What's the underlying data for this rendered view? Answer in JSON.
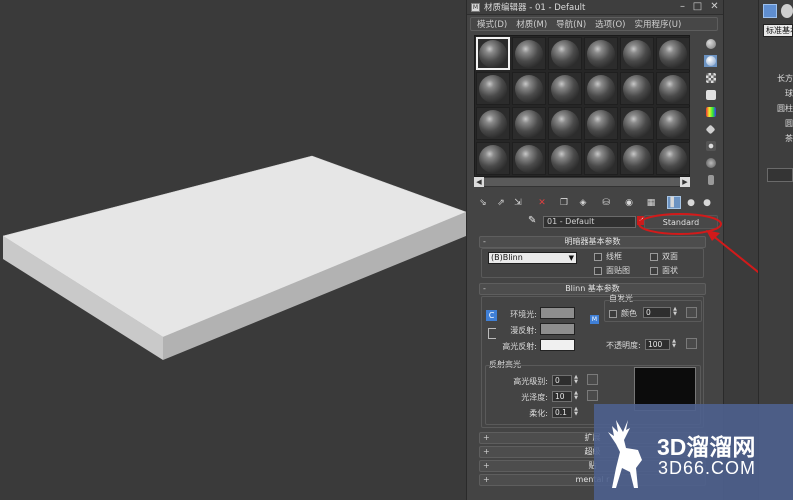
{
  "window": {
    "icon_text": "M",
    "title": "材质编辑器 - 01 - Default",
    "minimize": "–",
    "maximize": "□",
    "close": "✕"
  },
  "menu": [
    "模式(D)",
    "材质(M)",
    "导航(N)",
    "选项(O)",
    "实用程序(U)"
  ],
  "slots": {
    "rows": 4,
    "columns": 6,
    "active_index": 0
  },
  "scrollbar": {
    "left_arrow": "◀",
    "right_arrow": "▶"
  },
  "material": {
    "name": "01 - Default",
    "type_button": "Standard",
    "eyedropper_icon": "eyedropper-icon",
    "red_check_icon": "check-icon"
  },
  "shader_rollout": {
    "toggle": "-",
    "title": "明暗器基本参数",
    "shader": "(B)Blinn",
    "checkboxes": [
      {
        "label": "线框",
        "checked": false
      },
      {
        "label": "双面",
        "checked": false
      },
      {
        "label": "面贴图",
        "checked": false
      },
      {
        "label": "面状",
        "checked": false
      }
    ]
  },
  "blinn_rollout": {
    "toggle": "-",
    "title": "Blinn 基本参数",
    "ambient_label": "环境光:",
    "diffuse_label": "漫反射:",
    "specular_label": "高光反射:",
    "self_illum_title": "自发光",
    "color_label": "颜色",
    "color_value": "0",
    "opacity_label": "不透明度:",
    "opacity_value": "100",
    "lock_button": "C",
    "map_button": "M"
  },
  "specular_highlights": {
    "title": "反射高光",
    "level_label": "高光级别:",
    "level_value": "0",
    "gloss_label": "光泽度:",
    "gloss_value": "10",
    "soften_label": "柔化:",
    "soften_value": "0.1"
  },
  "collapsed_rollouts": [
    {
      "toggle": "+",
      "title": "扩展"
    },
    {
      "toggle": "+",
      "title": "超级"
    },
    {
      "toggle": "+",
      "title": "贴"
    },
    {
      "toggle": "+",
      "title": "mental r"
    }
  ],
  "command_panel": {
    "dropdown": "标准基本",
    "buttons": [
      "长方",
      "球",
      "圆柱",
      "圆",
      "茶"
    ]
  },
  "watermark": {
    "title": "3D溜溜网",
    "url": "3D66.COM"
  },
  "colors": {
    "viewport_bg": "#3a3a3a",
    "box_top": "#e6e6e6",
    "box_front": "#c9c9c9",
    "box_side": "#b2b2b2",
    "annotation_red": "#d21a1a",
    "ambient_swatch": "#8e8e8e",
    "diffuse_swatch": "#8e8e8e",
    "specular_swatch": "#f0f0f0",
    "watermark_bg": "#4e618e"
  }
}
